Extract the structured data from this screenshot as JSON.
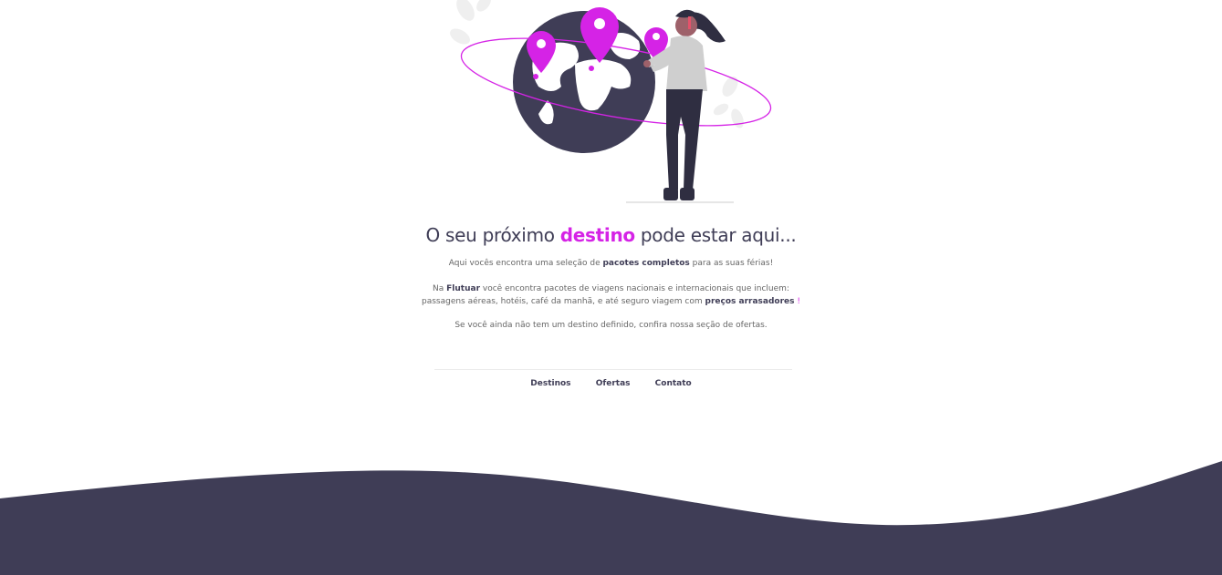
{
  "hero": {
    "illustration": "woman-placing-pins-on-globe-illustration",
    "colors": {
      "accent": "#d523e6",
      "dark": "#3f3d56"
    }
  },
  "headline": {
    "before": "O seu próximo",
    "highlight": "destino",
    "after": "pode estar aqui..."
  },
  "intro": {
    "p1_before": "Aqui vocês encontra uma seleção de",
    "p1_bold": "pacotes completos",
    "p1_after": "para as suas férias!",
    "p2_before": "Na",
    "p2_brand": "Flutuar",
    "p2_mid": "você encontra pacotes de viagens nacionais e internacionais que incluem:",
    "p2_line2": "passagens aéreas, hotéis, café da manhã, e até seguro viagem com",
    "p2_bold": "preços arrasadores",
    "p2_end": "!",
    "p3": "Se você ainda não tem um destino definido, confira nossa seção de ofertas."
  },
  "nav": {
    "items": [
      "Destinos",
      "Ofertas",
      "Contato"
    ]
  },
  "footer": {
    "wave_color": "#3f3d56"
  }
}
